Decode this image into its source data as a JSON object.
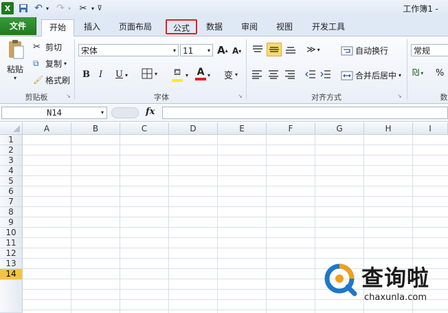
{
  "window": {
    "title": "工作簿1 -"
  },
  "tabs": [
    "文件",
    "开始",
    "插入",
    "页面布局",
    "公式",
    "数据",
    "审阅",
    "视图",
    "开发工具"
  ],
  "clipboard": {
    "paste": "粘贴",
    "cut": "剪切",
    "copy": "复制",
    "format_painter": "格式刷",
    "group": "剪贴板"
  },
  "font": {
    "name": "宋体",
    "size": "11",
    "grow": "A",
    "shrink": "A",
    "bold": "B",
    "italic": "I",
    "underline": "U",
    "phonetic": "变",
    "group": "字体"
  },
  "align": {
    "wrap": "自动换行",
    "merge": "合并后居中",
    "group": "对齐方式"
  },
  "number": {
    "format": "常规",
    "percent": "%",
    "group": "数"
  },
  "formula_bar": {
    "name_box": "N14",
    "fx": "fx"
  },
  "columns": [
    "A",
    "B",
    "C",
    "D",
    "E",
    "F",
    "G",
    "H",
    "I"
  ],
  "rows": [
    "1",
    "2",
    "3",
    "4",
    "5",
    "6",
    "7",
    "8",
    "9",
    "10",
    "11",
    "12",
    "13",
    "14"
  ],
  "selected_row": "14",
  "watermark": {
    "cn": "查询啦",
    "url": "chaxunla.com"
  },
  "colors": {
    "file_tab": "#1f7a1f",
    "highlight": "#dd2222",
    "selected_row": "#f5c342"
  }
}
